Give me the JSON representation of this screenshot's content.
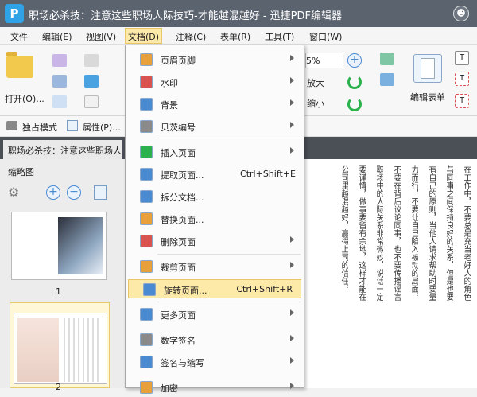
{
  "title": {
    "logo": "P",
    "text": "职场必杀技：注意这些职场人际技巧-才能越混越好  -  迅捷PDF编辑器"
  },
  "menubar": [
    {
      "label": "文件"
    },
    {
      "label": "编辑(E)"
    },
    {
      "label": "视图(V)"
    },
    {
      "label": "文档(D)",
      "active": true
    },
    {
      "label": "注释(C)"
    },
    {
      "label": "表单(R)"
    },
    {
      "label": "工具(T)"
    },
    {
      "label": "窗口(W)"
    }
  ],
  "ribbon": {
    "open_label": "打开(O)...",
    "zoom_value": "5%",
    "zoom_in_label": "放大",
    "zoom_out_label": "缩小",
    "edit_form_label": "编辑表单"
  },
  "toolbar2": {
    "exclusive_label": "独占模式",
    "properties_label": "属性(P)..."
  },
  "doc_tab": "职场必杀技：注意这些职场人",
  "sidebar": {
    "title": "缩略图",
    "page1": "1",
    "page2": "2"
  },
  "doc_columns": [
    "在工作中，不要总是充当老好人的角色",
    "与同事之间保持良好的关系，但是也要",
    "有自己的原则，当他人请求帮助时要量",
    "力而行，不要让自己陷入被动的局面。",
    "不要在背后议论同事，也不要传播谣言",
    "职场中的人际关系非常微妙，说话一定",
    "要谨慎，做事要留有余地，这样才能在",
    "公司里越混越好，赢得上司的信任。"
  ],
  "dropdown": {
    "items": [
      {
        "label": "页眉页脚",
        "submenu": true,
        "icon_color": "#e8a13a"
      },
      {
        "label": "水印",
        "submenu": true,
        "icon_color": "#d9534f"
      },
      {
        "label": "背景",
        "submenu": true,
        "icon_color": "#4a8ad0"
      },
      {
        "label": "贝茨编号",
        "submenu": true,
        "icon_color": "#8a8a8a"
      },
      {
        "label": "插入页面",
        "submenu": true,
        "icon_color": "#2bb24c"
      },
      {
        "label": "提取页面...",
        "shortcut": "Ctrl+Shift+E",
        "icon_color": "#4a8ad0"
      },
      {
        "label": "拆分文档...",
        "icon_color": "#4a8ad0"
      },
      {
        "label": "替换页面...",
        "icon_color": "#e8a13a"
      },
      {
        "label": "删除页面",
        "submenu": true,
        "icon_color": "#d9534f"
      },
      {
        "label": "裁剪页面",
        "submenu": true,
        "icon_color": "#e8a13a"
      },
      {
        "label": "旋转页面...",
        "shortcut": "Ctrl+Shift+R",
        "highlight": true,
        "icon_color": "#4a8ad0"
      },
      {
        "label": "更多页面",
        "submenu": true,
        "icon_color": "#4a8ad0"
      },
      {
        "label": "数字签名",
        "submenu": true,
        "icon_color": "#8a8a8a"
      },
      {
        "label": "签名与缩写",
        "submenu": true,
        "icon_color": "#4a8ad0"
      },
      {
        "label": "加密",
        "submenu": true,
        "icon_color": "#e8a13a"
      }
    ]
  }
}
